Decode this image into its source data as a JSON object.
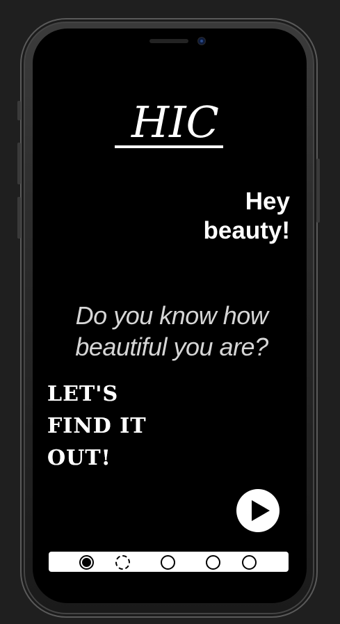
{
  "app": {
    "logo_text": "HIC",
    "greeting": "Hey beauty!",
    "question": "Do you know how beautiful you are?",
    "cta_lines": [
      "LET'S",
      "FIND IT",
      "OUT!"
    ],
    "play_icon": "play-icon"
  },
  "pager": {
    "pages": 5,
    "active_index": 0
  },
  "colors": {
    "background": "#000000",
    "text": "#ffffff",
    "question_text": "#d6d6d6",
    "frame": "#2a2a2a"
  }
}
